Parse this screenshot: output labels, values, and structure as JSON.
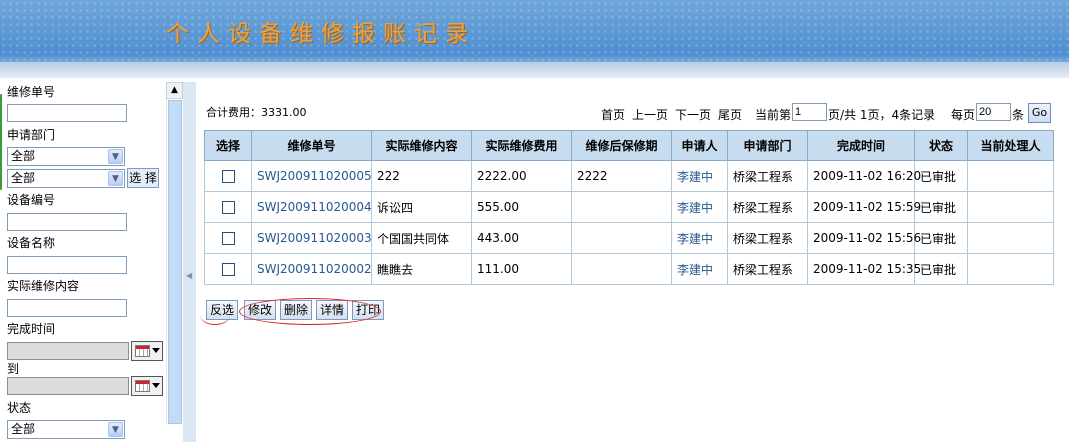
{
  "header": {
    "title": "个人设备维修报账记录"
  },
  "sidebar": {
    "repair_no_label": "维修单号",
    "repair_no_value": "",
    "dept_label": "申请部门",
    "dept_select_1": "全部",
    "dept_select_2": "全部",
    "select_button": "选 择",
    "equip_no_label": "设备编号",
    "equip_no_value": "",
    "equip_name_label": "设备名称",
    "equip_name_value": "",
    "actual_content_label": "实际维修内容",
    "actual_content_value": "",
    "finish_time_label": "完成时间",
    "to_label": "到",
    "status_label": "状态",
    "status_select": "全部"
  },
  "summary": {
    "total_label": "合计费用：3331.00"
  },
  "pager": {
    "first": "首页",
    "prev": "上一页",
    "next": "下一页",
    "last": "尾页",
    "current_prefix": "当前第",
    "current_value": "1",
    "pages_text": "页/共 1页，4条记录",
    "per_page_prefix": "每页",
    "per_page_value": "20",
    "per_page_suffix": "条",
    "go": "Go"
  },
  "table": {
    "columns": [
      "选择",
      "维修单号",
      "实际维修内容",
      "实际维修费用",
      "维修后保修期",
      "申请人",
      "申请部门",
      "完成时间",
      "状态",
      "当前处理人"
    ],
    "rows": [
      {
        "id": "SWJ200911020005",
        "content": "222",
        "cost": "2222.00",
        "warranty": "2222",
        "applicant": "李建中",
        "dept": "桥梁工程系",
        "finish": "2009-11-02 16:20",
        "status": "已审批",
        "handler": ""
      },
      {
        "id": "SWJ200911020004",
        "content": "诉讼四",
        "cost": "555.00",
        "warranty": "",
        "applicant": "李建中",
        "dept": "桥梁工程系",
        "finish": "2009-11-02 15:59",
        "status": "已审批",
        "handler": ""
      },
      {
        "id": "SWJ200911020003",
        "content": "个国国共同体",
        "cost": "443.00",
        "warranty": "",
        "applicant": "李建中",
        "dept": "桥梁工程系",
        "finish": "2009-11-02 15:56",
        "status": "已审批",
        "handler": ""
      },
      {
        "id": "SWJ200911020002",
        "content": "瞧瞧去",
        "cost": "111.00",
        "warranty": "",
        "applicant": "李建中",
        "dept": "桥梁工程系",
        "finish": "2009-11-02 15:35",
        "status": "已审批",
        "handler": ""
      }
    ]
  },
  "actions": {
    "invert": "反选",
    "edit": "修改",
    "delete": "删除",
    "detail": "详情",
    "print": "打印"
  }
}
